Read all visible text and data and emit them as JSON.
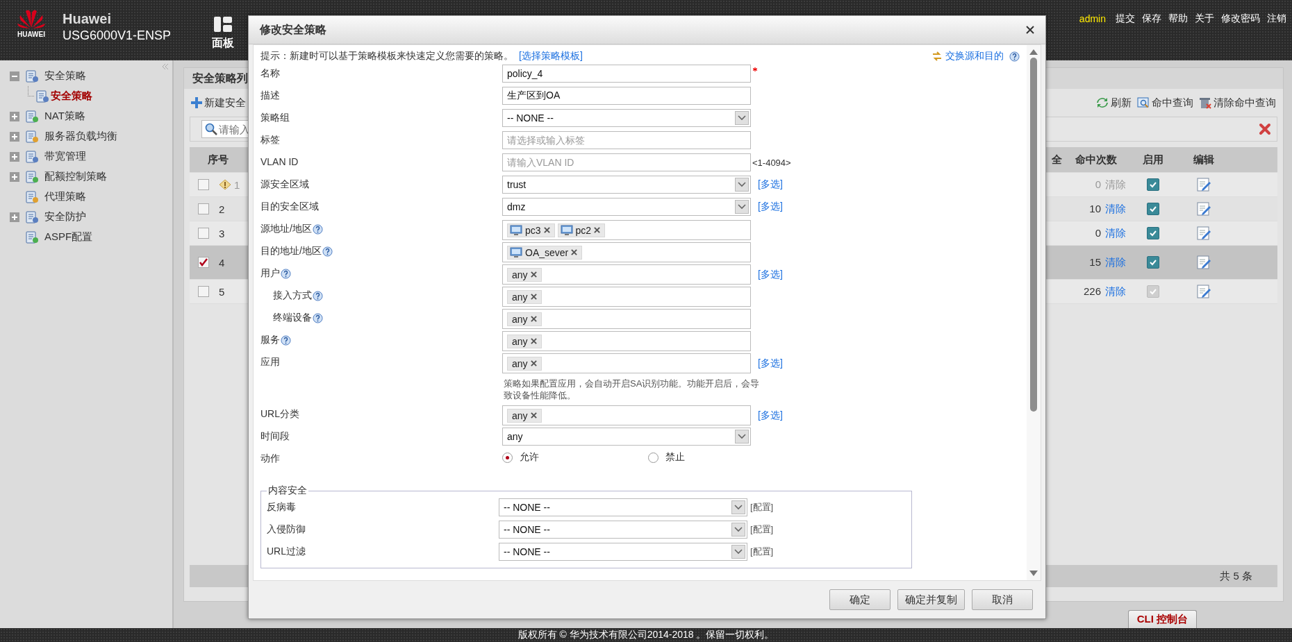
{
  "header": {
    "brand": "Huawei",
    "logo_text": "HUAWEI",
    "product": "USG6000V1-ENSP",
    "nav": [
      {
        "label": "面板",
        "selected": false
      }
    ],
    "user": "admin",
    "links": [
      "提交",
      "保存",
      "帮助",
      "关于",
      "修改密码",
      "注销"
    ]
  },
  "sidebar": {
    "items": [
      {
        "label": "安全策略",
        "expanded": true,
        "children": [
          {
            "label": "安全策略",
            "selected": true
          }
        ]
      },
      {
        "label": "NAT策略",
        "expanded": false
      },
      {
        "label": "服务器负载均衡",
        "expanded": false
      },
      {
        "label": "带宽管理",
        "expanded": false
      },
      {
        "label": "配额控制策略",
        "expanded": false
      },
      {
        "label": "代理策略"
      },
      {
        "label": "安全防护",
        "expanded": false
      },
      {
        "label": "ASPF配置"
      }
    ]
  },
  "panel": {
    "title": "安全策略列",
    "new_button": "新建安全",
    "tools": [
      "刷新",
      "命中查询",
      "清除命中查询"
    ],
    "search": {
      "placeholder": "请输入"
    },
    "table": {
      "columns": [
        "序号",
        "全",
        "命中次数",
        "启用",
        "编辑"
      ],
      "rows": [
        {
          "id": "1",
          "warning": true,
          "checked": false,
          "selected": false,
          "hits": "0",
          "clear": "清除",
          "clear_disabled": true,
          "enabled": true,
          "enabled_disabled": false
        },
        {
          "id": "2",
          "warning": false,
          "checked": false,
          "selected": false,
          "hits": "10",
          "clear": "清除",
          "clear_disabled": false,
          "enabled": true,
          "enabled_disabled": false
        },
        {
          "id": "3",
          "warning": false,
          "checked": false,
          "selected": false,
          "hits": "0",
          "clear": "清除",
          "clear_disabled": false,
          "enabled": true,
          "enabled_disabled": false
        },
        {
          "id": "4",
          "warning": false,
          "checked": true,
          "selected": true,
          "hits": "15",
          "clear": "清除",
          "clear_disabled": false,
          "enabled": true,
          "enabled_disabled": false
        },
        {
          "id": "5",
          "warning": false,
          "checked": false,
          "selected": false,
          "hits": "226",
          "clear": "清除",
          "clear_disabled": false,
          "enabled": true,
          "enabled_disabled": true
        }
      ]
    },
    "total": "共 5 条"
  },
  "cli_tab": "CLI 控制台",
  "copyright": "版权所有 © 华为技术有限公司2014-2018 。保留一切权利。",
  "dialog": {
    "title": "修改安全策略",
    "hint": "提示：新建时可以基于策略模板来快速定义您需要的策略。",
    "hint_link": "[选择策略模板]",
    "swap_link": "交换源和目的",
    "fields": [
      {
        "label": "名称",
        "kind": "text",
        "value": "policy_4",
        "required": true
      },
      {
        "label": "描述",
        "kind": "text",
        "value": "生产区到OA"
      },
      {
        "label": "策略组",
        "kind": "select",
        "value": "-- NONE --"
      },
      {
        "label": "标签",
        "kind": "text",
        "placeholder": "请选择或输入标签"
      },
      {
        "label": "VLAN ID",
        "kind": "text",
        "placeholder": "请输入VLAN ID",
        "range": "<1-4094>"
      },
      {
        "label": "源安全区域",
        "kind": "select",
        "value": "trust",
        "multi": "[多选]"
      },
      {
        "label": "目的安全区域",
        "kind": "select",
        "value": "dmz",
        "multi": "[多选]"
      },
      {
        "label": "源地址/地区",
        "kind": "tags",
        "help": true,
        "tags": [
          {
            "text": "pc3",
            "kind": "address"
          },
          {
            "text": "pc2",
            "kind": "address"
          }
        ]
      },
      {
        "label": "目的地址/地区",
        "kind": "tags",
        "help": true,
        "tags": [
          {
            "text": "OA_sever",
            "kind": "address"
          }
        ]
      },
      {
        "label": "用户",
        "kind": "tags",
        "help": true,
        "tags": [
          {
            "text": "any",
            "kind": "plain"
          }
        ],
        "multi": "[多选]",
        "children": [
          {
            "label": "接入方式",
            "kind": "tags",
            "help": true,
            "tags": [
              {
                "text": "any",
                "kind": "plain"
              }
            ]
          },
          {
            "label": "终端设备",
            "kind": "tags",
            "help": true,
            "tags": [
              {
                "text": "any",
                "kind": "plain"
              }
            ]
          }
        ]
      },
      {
        "label": "服务",
        "kind": "tags",
        "help": true,
        "tags": [
          {
            "text": "any",
            "kind": "plain"
          }
        ]
      },
      {
        "label": "应用",
        "kind": "tags",
        "tags": [
          {
            "text": "any",
            "kind": "plain"
          }
        ],
        "multi": "[多选]",
        "note": "策略如果配置应用，会自动开启SA识别功能。功能开启后，会导致设备性能降低。"
      },
      {
        "label": "URL分类",
        "kind": "tags",
        "tags": [
          {
            "text": "any",
            "kind": "plain"
          }
        ],
        "multi": "[多选]"
      },
      {
        "label": "时间段",
        "kind": "select",
        "value": "any"
      },
      {
        "label": "动作",
        "kind": "radio",
        "options": [
          {
            "label": "允许",
            "selected": true
          },
          {
            "label": "禁止",
            "selected": false
          }
        ]
      }
    ],
    "content_security": {
      "legend": "内容安全",
      "fields": [
        {
          "label": "反病毒",
          "value": "-- NONE --",
          "link": "[配置]"
        },
        {
          "label": "入侵防御",
          "value": "-- NONE --",
          "link": "[配置]"
        },
        {
          "label": "URL过滤",
          "value": "-- NONE --",
          "link": "[配置]"
        }
      ]
    },
    "buttons": [
      "确定",
      "确定并复制",
      "取消"
    ]
  }
}
